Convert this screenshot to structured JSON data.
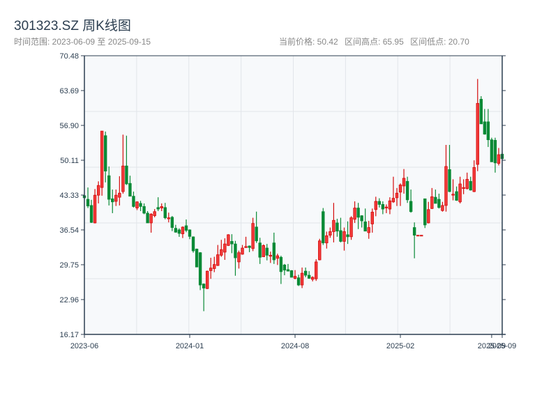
{
  "header": {
    "title": "301323.SZ 周K线图",
    "range_text": "时间范围: 2023-06-09 至 2025-09-15",
    "current_price": "当前价格: 50.42",
    "range_high": "区间高点: 65.95",
    "range_low": "区间低点: 20.70"
  },
  "colors": {
    "up": "#d40c0c",
    "up_fill": "#f23a3a",
    "down": "#0a8a36",
    "axis": "#2c3e50",
    "plot_bg": "#f7f9fb",
    "grid": "#e2e5ea"
  },
  "chart_data": {
    "type": "candlestick",
    "title": "301323.SZ 周K线图",
    "ylim": [
      16.17,
      70.48
    ],
    "y_ticks": [
      "70.48",
      "63.69",
      "56.90",
      "50.11",
      "43.33",
      "36.54",
      "29.75",
      "22.96",
      "16.17"
    ],
    "x_ticks": [
      {
        "label": "2023-06",
        "index": 0
      },
      {
        "label": "2024-01",
        "index": 30
      },
      {
        "label": "2024-08",
        "index": 60
      },
      {
        "label": "2025-02",
        "index": 90
      },
      {
        "label": "2025-09",
        "index": 116
      },
      {
        "label": "2025-09",
        "index": 119
      }
    ],
    "grid": true,
    "ohlc_fields": [
      "open",
      "high",
      "low",
      "close"
    ],
    "candles": [
      [
        43.2,
        43.3,
        42.6,
        42.8
      ],
      [
        42.5,
        44.8,
        40.8,
        41.2
      ],
      [
        41.3,
        42.4,
        37.9,
        38.0
      ],
      [
        37.9,
        44.5,
        37.8,
        43.3
      ],
      [
        43.3,
        46.0,
        41.7,
        45.2
      ],
      [
        44.8,
        55.8,
        43.2,
        55.8
      ],
      [
        54.9,
        55.7,
        45.8,
        48.0
      ],
      [
        47.1,
        48.9,
        41.3,
        42.5
      ],
      [
        42.6,
        44.4,
        39.8,
        42.0
      ],
      [
        42.1,
        44.4,
        41.2,
        43.3
      ],
      [
        42.9,
        47.0,
        41.3,
        43.7
      ],
      [
        44.0,
        55.1,
        43.6,
        49.0
      ],
      [
        49.0,
        54.9,
        45.3,
        45.5
      ],
      [
        45.6,
        47.1,
        43.1,
        43.1
      ],
      [
        43.1,
        44.0,
        40.9,
        41.1
      ],
      [
        40.8,
        42.1,
        40.4,
        42.0
      ],
      [
        41.7,
        42.2,
        40.2,
        41.1
      ],
      [
        41.1,
        41.7,
        39.6,
        39.8
      ],
      [
        39.8,
        40.2,
        37.9,
        37.9
      ],
      [
        37.9,
        39.8,
        36.0,
        39.6
      ],
      [
        39.3,
        40.6,
        39.0,
        40.1
      ],
      [
        40.9,
        42.9,
        40.2,
        40.6
      ],
      [
        40.8,
        41.7,
        40.2,
        41.1
      ],
      [
        40.9,
        41.8,
        38.6,
        38.9
      ],
      [
        38.7,
        39.9,
        38.0,
        38.9
      ],
      [
        39.0,
        39.25,
        36.3,
        37.0
      ],
      [
        36.85,
        37.53,
        35.99,
        36.09
      ],
      [
        36.54,
        36.85,
        35.18,
        35.86
      ],
      [
        35.77,
        37.22,
        34.95,
        37.08
      ],
      [
        37.35,
        38.57,
        36.09,
        36.45
      ],
      [
        36.54,
        36.63,
        34.73,
        35.27
      ],
      [
        35.18,
        35.27,
        32.1,
        32.46
      ],
      [
        32.8,
        32.9,
        29.3,
        29.3
      ],
      [
        32.1,
        32.2,
        24.8,
        25.8
      ],
      [
        26.0,
        26.1,
        20.7,
        25.2
      ],
      [
        25.1,
        28.6,
        25.0,
        28.5
      ],
      [
        28.6,
        31.1,
        27.0,
        29.1
      ],
      [
        29.0,
        31.3,
        28.3,
        29.8
      ],
      [
        29.6,
        33.6,
        29.5,
        31.7
      ],
      [
        31.6,
        34.6,
        31.3,
        32.7
      ],
      [
        32.2,
        34.9,
        30.7,
        33.8
      ],
      [
        33.5,
        35.7,
        33.4,
        35.6
      ],
      [
        34.3,
        35.7,
        32.0,
        33.8
      ],
      [
        33.8,
        34.4,
        27.6,
        31.1
      ],
      [
        30.3,
        32.5,
        29.0,
        32.1
      ],
      [
        31.8,
        33.6,
        31.7,
        33.0
      ],
      [
        33.1,
        35.2,
        33.0,
        33.3
      ],
      [
        33.4,
        33.5,
        32.2,
        33.1
      ],
      [
        32.9,
        38.9,
        32.4,
        37.8
      ],
      [
        37.1,
        40.1,
        34.0,
        34.4
      ],
      [
        34.0,
        35.0,
        29.9,
        31.2
      ],
      [
        31.3,
        33.7,
        31.3,
        33.5
      ],
      [
        33.0,
        33.8,
        30.6,
        31.6
      ],
      [
        31.4,
        32.3,
        30.1,
        31.6
      ],
      [
        34.0,
        36.0,
        29.9,
        30.7
      ],
      [
        31.0,
        31.9,
        29.7,
        31.5
      ],
      [
        31.2,
        31.5,
        26.0,
        28.4
      ],
      [
        29.7,
        29.9,
        27.7,
        28.7
      ],
      [
        28.8,
        29.9,
        28.5,
        28.5
      ],
      [
        28.6,
        28.7,
        27.3,
        27.3
      ],
      [
        27.1,
        28.7,
        26.9,
        27.5
      ],
      [
        27.2,
        27.8,
        25.6,
        25.8
      ],
      [
        25.8,
        29.2,
        25.2,
        28.1
      ],
      [
        28.5,
        29.2,
        27.3,
        27.7
      ],
      [
        27.7,
        28.5,
        27.0,
        27.1
      ],
      [
        26.9,
        27.5,
        26.5,
        27.3
      ],
      [
        27.0,
        30.8,
        26.6,
        30.3
      ],
      [
        30.7,
        34.8,
        30.6,
        34.4
      ],
      [
        40.1,
        40.8,
        33.6,
        34.0
      ],
      [
        34.0,
        36.2,
        32.9,
        35.4
      ],
      [
        35.5,
        37.0,
        35.0,
        36.2
      ],
      [
        36.2,
        41.8,
        34.1,
        38.4
      ],
      [
        37.9,
        38.7,
        35.2,
        36.3
      ],
      [
        36.4,
        38.9,
        34.1,
        34.3
      ],
      [
        34.3,
        37.0,
        32.5,
        36.2
      ],
      [
        35.6,
        38.2,
        33.8,
        35.2
      ],
      [
        35.2,
        39.2,
        34.6,
        38.9
      ],
      [
        38.6,
        42.1,
        37.9,
        40.8
      ],
      [
        40.8,
        41.8,
        36.7,
        39.0
      ],
      [
        39.3,
        39.4,
        37.0,
        38.3
      ],
      [
        38.1,
        40.7,
        36.3,
        36.3
      ],
      [
        36.0,
        38.3,
        34.8,
        37.0
      ],
      [
        37.7,
        40.7,
        36.0,
        40.0
      ],
      [
        40.5,
        43.0,
        39.2,
        42.1
      ],
      [
        42.1,
        42.7,
        40.9,
        41.5
      ],
      [
        41.5,
        42.1,
        39.6,
        40.6
      ],
      [
        40.8,
        41.5,
        39.8,
        41.0
      ],
      [
        40.6,
        42.9,
        39.6,
        42.2
      ],
      [
        42.0,
        46.9,
        41.8,
        42.7
      ],
      [
        42.8,
        44.7,
        41.2,
        43.7
      ],
      [
        43.9,
        45.6,
        41.2,
        45.3
      ],
      [
        45.1,
        48.4,
        43.6,
        46.6
      ],
      [
        46.0,
        46.9,
        41.8,
        42.4
      ],
      [
        42.1,
        44.4,
        39.9,
        40.1
      ],
      [
        37.0,
        38.0,
        31.0,
        35.5
      ],
      [
        35.5,
        35.5,
        35.5,
        35.5
      ],
      [
        35.5,
        35.5,
        35.5,
        35.5
      ],
      [
        42.6,
        42.6,
        36.9,
        37.5
      ],
      [
        37.9,
        42.0,
        37.8,
        40.5
      ],
      [
        40.7,
        44.7,
        40.6,
        43.0
      ],
      [
        42.9,
        44.4,
        41.7,
        41.7
      ],
      [
        42.5,
        43.6,
        40.7,
        40.9
      ],
      [
        40.3,
        42.0,
        40.1,
        41.3
      ],
      [
        41.3,
        53.1,
        40.1,
        48.9
      ],
      [
        48.3,
        53.1,
        43.9,
        44.0
      ],
      [
        43.3,
        46.4,
        42.3,
        43.5
      ],
      [
        44.0,
        45.0,
        42.2,
        42.3
      ],
      [
        42.0,
        46.9,
        41.7,
        45.5
      ],
      [
        44.6,
        46.4,
        43.5,
        44.8
      ],
      [
        44.6,
        47.7,
        44.4,
        46.4
      ],
      [
        46.0,
        46.9,
        44.2,
        44.3
      ],
      [
        44.0,
        50.1,
        43.9,
        48.7
      ],
      [
        49.3,
        65.95,
        48.0,
        61.2
      ],
      [
        62.0,
        62.6,
        57.2,
        57.2
      ],
      [
        57.6,
        60.1,
        55.1,
        55.2
      ],
      [
        57.6,
        60.1,
        52.7,
        54.1
      ],
      [
        54.1,
        54.5,
        49.8,
        49.8
      ],
      [
        54.0,
        54.5,
        47.7,
        49.6
      ],
      [
        49.5,
        52.5,
        49.1,
        51.2
      ],
      [
        51.3,
        51.7,
        50.3,
        50.42
      ]
    ]
  }
}
